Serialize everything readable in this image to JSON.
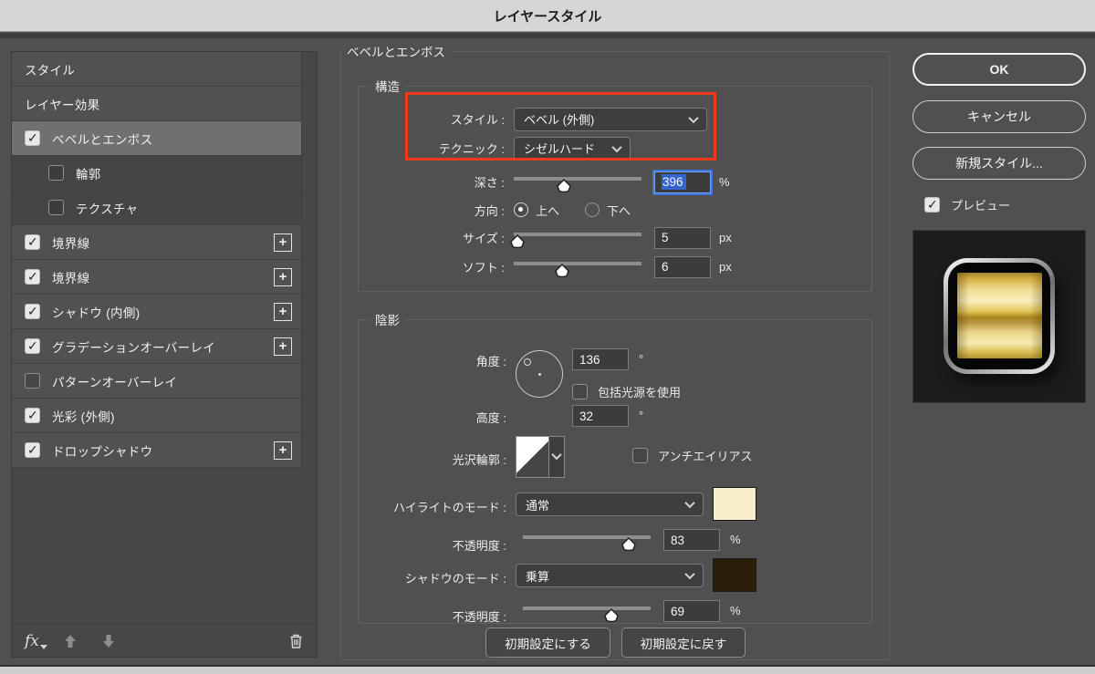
{
  "title_bar": {
    "title": "レイヤースタイル"
  },
  "colors": {
    "annotation": "#ee3b1c",
    "focus_ring": "#3f74d8",
    "highlight_swatch": "#f9efcd",
    "shadow_swatch": "#2b1e07"
  },
  "sidebar": {
    "items": [
      {
        "label": "スタイル",
        "checkbox": null,
        "selected": false,
        "plus": false
      },
      {
        "label": "レイヤー効果",
        "checkbox": null,
        "selected": false,
        "plus": false
      },
      {
        "label": "ベベルとエンボス",
        "checkbox": true,
        "selected": true,
        "plus": false
      },
      {
        "label": "輪郭",
        "checkbox": false,
        "selected": false,
        "plus": false,
        "sub": true
      },
      {
        "label": "テクスチャ",
        "checkbox": false,
        "selected": false,
        "plus": false,
        "sub": true
      },
      {
        "label": "境界線",
        "checkbox": true,
        "selected": false,
        "plus": true
      },
      {
        "label": "境界線",
        "checkbox": true,
        "selected": false,
        "plus": true
      },
      {
        "label": "シャドウ (内側)",
        "checkbox": true,
        "selected": false,
        "plus": true
      },
      {
        "label": "グラデーションオーバーレイ",
        "checkbox": true,
        "selected": false,
        "plus": true
      },
      {
        "label": "パターンオーバーレイ",
        "checkbox": false,
        "selected": false,
        "plus": false
      },
      {
        "label": "光彩 (外側)",
        "checkbox": true,
        "selected": false,
        "plus": false
      },
      {
        "label": "ドロップシャドウ",
        "checkbox": true,
        "selected": false,
        "plus": true
      }
    ],
    "footer": {
      "fx_label": "fx"
    }
  },
  "main": {
    "section_title": "ベベルとエンボス",
    "structure": {
      "legend": "構造",
      "style_label": "スタイル :",
      "style_value": "ベベル (外側)",
      "technique_label": "テクニック :",
      "technique_value": "シゼルハード",
      "depth_label": "深さ :",
      "depth_value": "396",
      "depth_unit": "%",
      "direction_label": "方向 :",
      "direction_up": "上へ",
      "direction_down": "下へ",
      "direction_selected": "上へ",
      "size_label": "サイズ :",
      "size_value": "5",
      "size_unit": "px",
      "soften_label": "ソフト :",
      "soften_value": "6",
      "soften_unit": "px"
    },
    "shading": {
      "legend": "陰影",
      "angle_label": "角度 :",
      "angle_value": "136",
      "angle_unit": "°",
      "global_light_label": "包括光源を使用",
      "global_light_checked": false,
      "altitude_label": "高度 :",
      "altitude_value": "32",
      "altitude_unit": "°",
      "gloss_contour_label": "光沢輪郭 :",
      "antialias_label": "アンチエイリアス",
      "antialias_checked": false,
      "highlight_mode_label": "ハイライトのモード :",
      "highlight_mode_value": "通常",
      "highlight_opacity_label": "不透明度 :",
      "highlight_opacity_value": "83",
      "highlight_opacity_unit": "%",
      "shadow_mode_label": "シャドウのモード :",
      "shadow_mode_value": "乗算",
      "shadow_opacity_label": "不透明度 :",
      "shadow_opacity_value": "69",
      "shadow_opacity_unit": "%"
    },
    "footer_buttons": {
      "set_default": "初期設定にする",
      "reset_default": "初期設定に戻す"
    }
  },
  "actions": {
    "ok": "OK",
    "cancel": "キャンセル",
    "new_style": "新規スタイル...",
    "preview_label": "プレビュー",
    "preview_checked": true
  },
  "sliders": {
    "depth_pct": "39.6%",
    "size_pct": "3%",
    "soften_pct": "38%",
    "highlight_opacity_pct": "83%",
    "shadow_opacity_pct": "69%"
  }
}
